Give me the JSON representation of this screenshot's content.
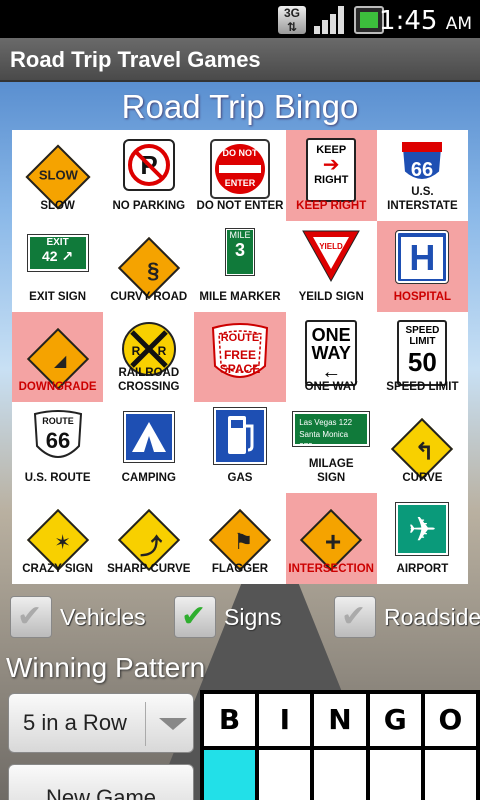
{
  "status": {
    "time": "1:45",
    "ampm": "AM",
    "network": "3G"
  },
  "app": {
    "title": "Road Trip Travel Games"
  },
  "bingo": {
    "title": "Road Trip Bingo",
    "cells": [
      {
        "label": "SLOW",
        "hit": true,
        "icon": "slow-sign-icon"
      },
      {
        "label": "NO PARKING",
        "hit": false,
        "icon": "no-parking-icon"
      },
      {
        "label": "DO NOT ENTER",
        "hit": false,
        "icon": "do-not-enter-icon"
      },
      {
        "label": "KEEP RIGHT",
        "hit": true,
        "icon": "keep-right-icon"
      },
      {
        "label": "U.S. INTERSTATE",
        "hit": false,
        "icon": "interstate-icon"
      },
      {
        "label": "EXIT SIGN",
        "hit": false,
        "icon": "exit-sign-icon"
      },
      {
        "label": "CURVY ROAD",
        "hit": false,
        "icon": "curvy-road-icon"
      },
      {
        "label": "MILE MARKER",
        "hit": false,
        "icon": "mile-marker-icon"
      },
      {
        "label": "YEILD SIGN",
        "hit": false,
        "icon": "yield-sign-icon"
      },
      {
        "label": "HOSPITAL",
        "hit": true,
        "icon": "hospital-icon"
      },
      {
        "label": "DOWNGRADE",
        "hit": true,
        "icon": "downgrade-icon"
      },
      {
        "label": "RAILROAD CROSSING",
        "hit": false,
        "icon": "railroad-crossing-icon"
      },
      {
        "label": "",
        "hit": true,
        "icon": "free-space-icon"
      },
      {
        "label": "ONE WAY",
        "hit": false,
        "icon": "one-way-icon"
      },
      {
        "label": "SPEED LIMIT",
        "hit": false,
        "icon": "speed-limit-icon"
      },
      {
        "label": "U.S. ROUTE",
        "hit": false,
        "icon": "us-route-icon"
      },
      {
        "label": "CAMPING",
        "hit": false,
        "icon": "camping-icon"
      },
      {
        "label": "GAS",
        "hit": false,
        "icon": "gas-icon"
      },
      {
        "label": "MILAGE SIGN",
        "hit": false,
        "icon": "milage-sign-icon"
      },
      {
        "label": "CURVE",
        "hit": false,
        "icon": "curve-icon"
      },
      {
        "label": "CRAZY SIGN",
        "hit": false,
        "icon": "crazy-sign-icon"
      },
      {
        "label": "SHARP CURVE",
        "hit": false,
        "icon": "sharp-curve-icon"
      },
      {
        "label": "FLAGGER",
        "hit": false,
        "icon": "flagger-icon"
      },
      {
        "label": "INTERSECTION",
        "hit": true,
        "icon": "intersection-icon"
      },
      {
        "label": "AIRPORT",
        "hit": false,
        "icon": "airport-icon"
      }
    ],
    "free_space": {
      "top": "ROUTE",
      "line1": "FREE",
      "line2": "SPACE"
    },
    "sign_text": {
      "slow": "SLOW",
      "do_not": "DO NOT",
      "enter": "ENTER",
      "keep": "KEEP",
      "right": "RIGHT",
      "interstate": "INTERSTATE",
      "route66": "66",
      "exit": "EXIT",
      "exit_num": "42",
      "mile": "MILE",
      "mile_num": "3",
      "yield": "YIELD",
      "one": "ONE",
      "way": "WAY",
      "speed": "SPEED",
      "limit": "LIMIT",
      "speed_num": "50",
      "route": "ROUTE",
      "rr": "R",
      "milage_line1": "Las Vegas 122",
      "milage_line2": "Santa Monica 373"
    }
  },
  "filters": [
    {
      "label": "Vehicles",
      "checked": false
    },
    {
      "label": "Signs",
      "checked": true
    },
    {
      "label": "Roadside",
      "checked": false
    }
  ],
  "winning": {
    "title": "Winning Pattern",
    "selected": "5 in a Row",
    "new_game": "New Game",
    "letters": [
      "B",
      "I",
      "N",
      "G",
      "O"
    ],
    "pattern": [
      true,
      false,
      false,
      false,
      false
    ],
    "highlight_color": "#22e0e8"
  },
  "colors": {
    "hit": "#f4a3a3",
    "hit_label": "#cc0000",
    "check": "#2fae2f"
  }
}
